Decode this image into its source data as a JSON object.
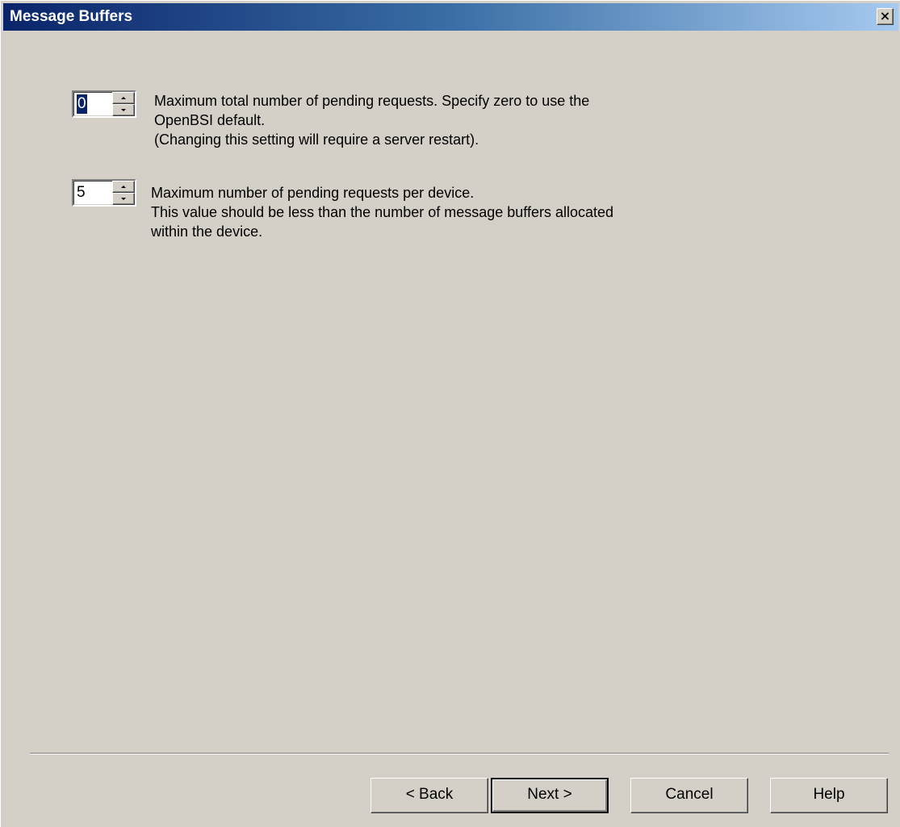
{
  "window": {
    "title": "Message Buffers",
    "close_glyph": "×"
  },
  "settings": [
    {
      "value": "0",
      "selected": true,
      "description_lines": [
        "Maximum total number of pending requests. Specify zero to use the",
        "OpenBSI default.",
        "(Changing this setting will require a server restart)."
      ]
    },
    {
      "value": "5",
      "selected": false,
      "description_lines": [
        "Maximum number of pending requests per device.",
        "This value should be less than the number of message buffers allocated",
        "within the device."
      ]
    }
  ],
  "buttons": {
    "back": "< Back",
    "next": "Next >",
    "cancel": "Cancel",
    "help": "Help"
  },
  "colors": {
    "titlebar_start": "#0a246a",
    "titlebar_end": "#a6caf0",
    "face": "#d4d0c8",
    "selection": "#0a246a"
  },
  "icons": {
    "close": "close-icon",
    "spin_up": "arrow-up-icon",
    "spin_down": "arrow-down-icon"
  }
}
